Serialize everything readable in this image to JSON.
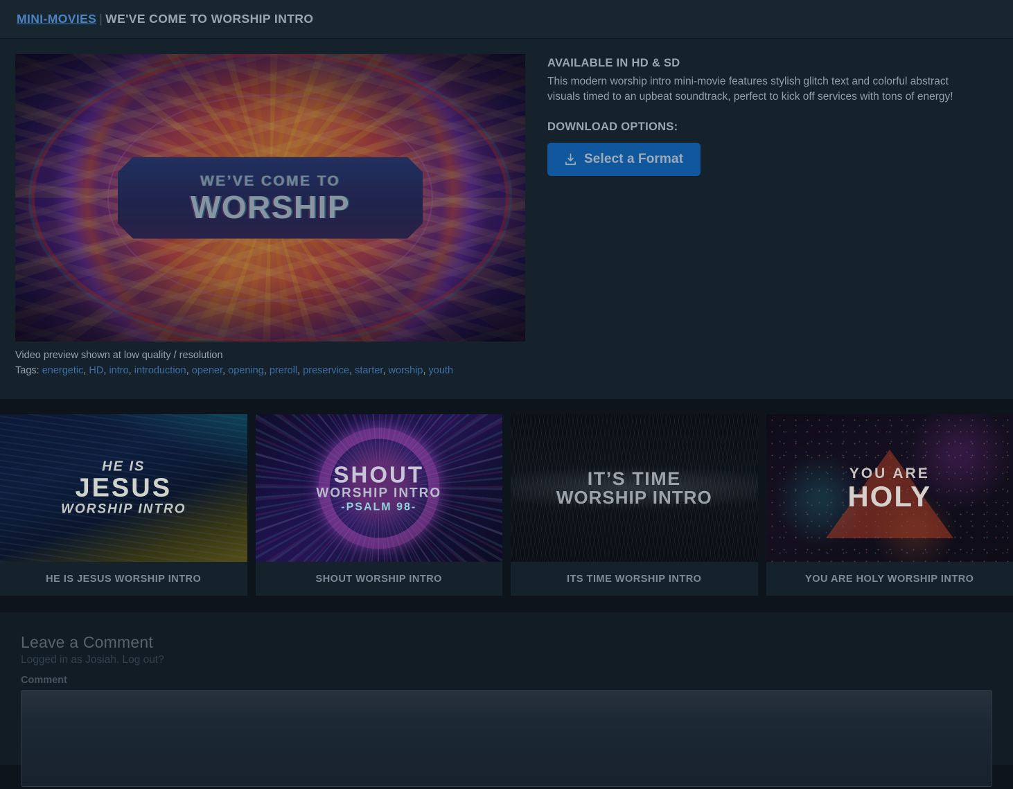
{
  "header": {
    "category": "MINI-MOVIES",
    "separator": "|",
    "title": "WE'VE COME TO WORSHIP INTRO"
  },
  "preview": {
    "plate_line1": "WE’VE COME TO",
    "plate_line2": "WORSHIP",
    "caption": "Video preview shown at low quality / resolution",
    "tags_label": "Tags:",
    "tags": [
      "energetic",
      "HD",
      "intro",
      "introduction",
      "opener",
      "opening",
      "preroll",
      "preservice",
      "starter",
      "worship",
      "youth"
    ]
  },
  "details": {
    "availability": "AVAILABLE IN HD & SD",
    "description": "This modern worship intro mini-movie features stylish glitch text and colorful abstract visuals timed to an upbeat soundtrack, perfect to kick off services with tons of energy!",
    "download_heading": "DOWNLOAD OPTIONS:",
    "format_button": "Select a Format",
    "format_button_icon": "download-icon",
    "button_color": "#11579e"
  },
  "related": [
    {
      "label": "HE IS JESUS WORSHIP INTRO",
      "thumb_line1": "HE IS",
      "thumb_line2": "JESUS",
      "thumb_line3": "WORSHIP INTRO"
    },
    {
      "label": "SHOUT WORSHIP INTRO",
      "thumb_line1": "SHOUT",
      "thumb_line2": "WORSHIP INTRO",
      "thumb_line3": "-PSALM 98-"
    },
    {
      "label": "ITS TIME WORSHIP INTRO",
      "thumb_line1": "IT’S TIME",
      "thumb_line2": "WORSHIP INTRO",
      "thumb_line3": ""
    },
    {
      "label": "YOU ARE HOLY WORSHIP INTRO",
      "thumb_line1": "YOU ARE",
      "thumb_line2": "HOLY",
      "thumb_line3": ""
    }
  ],
  "comments": {
    "heading": "Leave a Comment",
    "logged_in_prefix": "Logged in as Josiah.",
    "logout_link": "Log out?",
    "field_label": "Comment",
    "textarea_value": ""
  },
  "colors": {
    "page_bg": "#0d141b",
    "panel_bg": "#15222c",
    "header_bg": "#182630",
    "accent_link": "#3d6ea7",
    "accent_button": "#11579e"
  }
}
